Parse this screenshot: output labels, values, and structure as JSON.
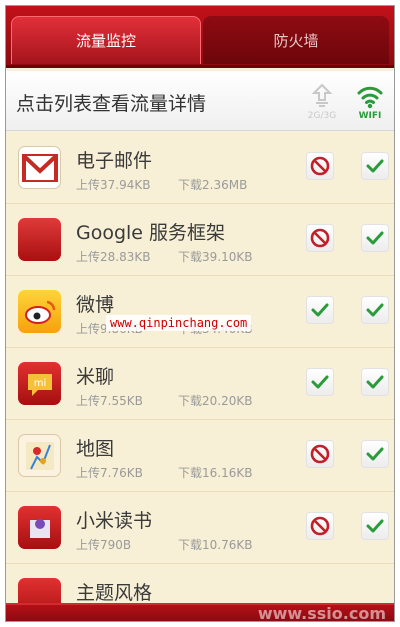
{
  "tabs": [
    {
      "label": "流量监控",
      "active": true
    },
    {
      "label": "防火墙",
      "active": false
    }
  ],
  "header": {
    "title": "点击列表查看流量详情",
    "net_2g_label": "2G/3G",
    "net_wifi_label": "WIFI"
  },
  "apps": [
    {
      "name": "电子邮件",
      "upload": "上传37.94KB",
      "download": "下载2.36MB",
      "mobile": "blocked",
      "wifi": "allowed",
      "icon": "gmail-icon"
    },
    {
      "name": "Google 服务框架",
      "upload": "上传28.83KB",
      "download": "下载39.10KB",
      "mobile": "blocked",
      "wifi": "allowed",
      "icon": "google-services-icon"
    },
    {
      "name": "微博",
      "upload": "上传9.86KB",
      "download": "下载34.40KB",
      "mobile": "allowed",
      "wifi": "allowed",
      "icon": "weibo-icon"
    },
    {
      "name": "米聊",
      "upload": "上传7.55KB",
      "download": "下载20.20KB",
      "mobile": "allowed",
      "wifi": "allowed",
      "icon": "miliao-icon"
    },
    {
      "name": "地图",
      "upload": "上传7.76KB",
      "download": "下载16.16KB",
      "mobile": "blocked",
      "wifi": "allowed",
      "icon": "maps-icon"
    },
    {
      "name": "小米读书",
      "upload": "上传790B",
      "download": "下载10.76KB",
      "mobile": "blocked",
      "wifi": "allowed",
      "icon": "mi-reader-icon"
    },
    {
      "name": "主题风格",
      "upload": "",
      "download": "",
      "mobile": "",
      "wifi": "",
      "icon": "themes-icon"
    }
  ],
  "watermark": "www.qinpinchang.com",
  "watermark_bottom": "www.ssio.com",
  "colors": {
    "accent_red": "#c2111a",
    "allowed_green": "#2a9a3a",
    "blocked_red": "#c0202a",
    "list_bg": "#f7f0d6"
  }
}
